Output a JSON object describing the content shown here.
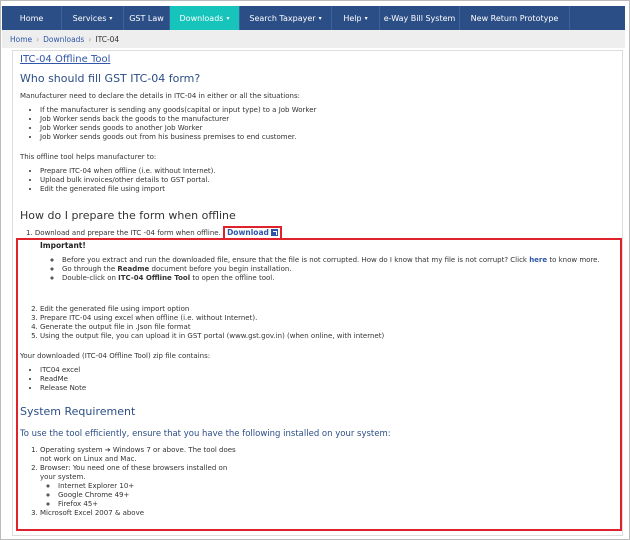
{
  "nav": {
    "items": [
      {
        "label": "Home",
        "caret": false,
        "active": false
      },
      {
        "label": "Services",
        "caret": true,
        "active": false
      },
      {
        "label": "GST Law",
        "caret": false,
        "active": false
      },
      {
        "label": "Downloads",
        "caret": true,
        "active": true
      },
      {
        "label": "Search Taxpayer",
        "caret": true,
        "active": false
      },
      {
        "label": "Help",
        "caret": true,
        "active": false
      },
      {
        "label": "e-Way Bill System",
        "caret": false,
        "active": false
      },
      {
        "label": "New Return Prototype",
        "caret": false,
        "active": false
      }
    ],
    "caret_glyph": "▾"
  },
  "breadcrumb": {
    "home": "Home",
    "downloads": "Downloads",
    "current": "ITC-04",
    "separator": "›"
  },
  "page": {
    "title_link": "ITC-04 Offline Tool",
    "who_heading": "Who should fill GST ITC-04 form?",
    "who_intro": "Manufacturer need to declare the details in ITC-04 in either or all the situations:",
    "who_items": [
      "If the manufacturer is sending any goods(capital or input type) to a Job Worker",
      "Job Worker sends back the goods to the manufacturer",
      "Job Worker sends goods to another Job Worker",
      "Job Worker sends goods out from his business premises to end customer."
    ],
    "helps_intro": "This offline tool helps manufacturer to:",
    "helps_items": [
      "Prepare ITC-04 when offline (i.e. without Internet).",
      "Upload bulk invoices/other details to GST portal.",
      "Edit the generated file using import"
    ],
    "how_heading": "How do I prepare the form when offline",
    "step1_text": "Download and prepare the ITC -04 form when offline.",
    "download_label": "Download",
    "important_label": "Important!",
    "important_items": {
      "item1_pre": "Before you extract and run the downloaded file, ensure that the file is not corrupted. How do I know that my file is not corrupt? Click ",
      "item1_link": "here",
      "item1_post": " to know more.",
      "item2_pre": "Go through the ",
      "item2_bold": "Readme",
      "item2_post": " document before you begin installation.",
      "item3_pre": "Double-click on ",
      "item3_bold": "ITC-04 Offline Tool",
      "item3_post": " to open the offline tool."
    },
    "steps_rest": [
      "Edit the generated file using import option",
      "Prepare ITC-04 using excel when offline (i.e. without Internet).",
      "Generate the output file in .Json file format",
      "Using the output file, you can upload it in GST portal (www.gst.gov.in) (when online, with internet)"
    ],
    "zip_intro": "Your downloaded (ITC-04 Offline Tool) zip file contains:",
    "zip_items": [
      "ITC04 excel",
      "ReadMe",
      "Release Note"
    ],
    "sysreq_heading": "System Requirement",
    "sysreq_sub": "To use the tool efficiently, ensure that you have the following installed on your system:",
    "req1_line1": "Operating system ➔ Windows 7 or above. The tool does",
    "req1_line2": "not work on Linux and Mac.",
    "req2_line1": "Browser: You need one of these browsers installed on",
    "req2_line2": "your system.",
    "browsers": [
      "Internet Explorer 10+",
      "Google Chrome 49+",
      "Firefox 45+"
    ],
    "req3": "Microsoft Excel 2007 & above"
  },
  "colors": {
    "nav_bg": "#2c4e86",
    "nav_active": "#17c4bb",
    "link": "#2f56a8",
    "highlight_border": "#e0222d"
  }
}
